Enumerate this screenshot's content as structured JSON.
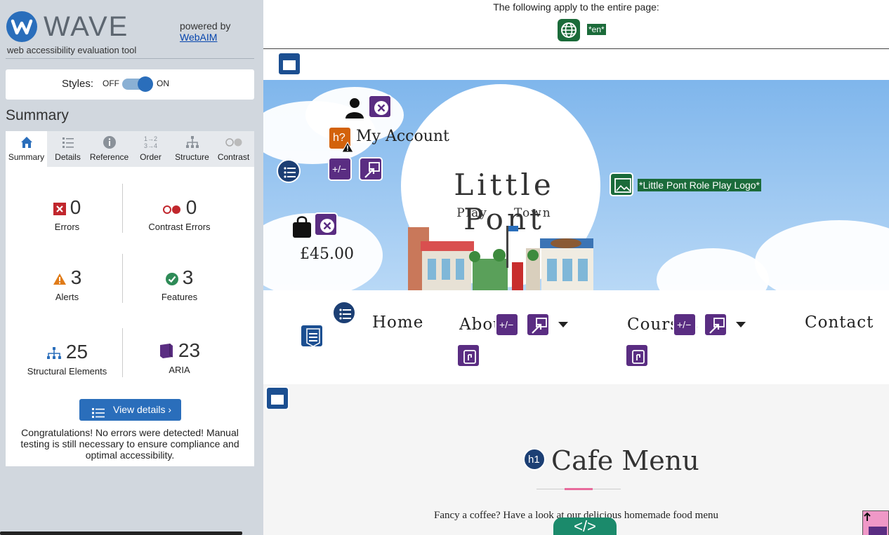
{
  "sidebar": {
    "logo_word": "WAVE",
    "logo_sub": "web accessibility evaluation tool",
    "powered_by": "powered by",
    "powered_link": "WebAIM",
    "styles_label": "Styles:",
    "styles_off": "OFF",
    "styles_on": "ON",
    "summary_title": "Summary",
    "tabs": [
      {
        "label": "Summary",
        "icon": "home-icon",
        "active": true
      },
      {
        "label": "Details",
        "icon": "list-icon"
      },
      {
        "label": "Reference",
        "icon": "info-icon"
      },
      {
        "label": "Order",
        "icon": "order-icon"
      },
      {
        "label": "Structure",
        "icon": "structure-icon"
      },
      {
        "label": "Contrast",
        "icon": "contrast-icon"
      }
    ],
    "stats": {
      "errors": {
        "value": "0",
        "label": "Errors"
      },
      "contrast_errors": {
        "value": "0",
        "label": "Contrast Errors"
      },
      "alerts": {
        "value": "3",
        "label": "Alerts"
      },
      "features": {
        "value": "3",
        "label": "Features"
      },
      "structural": {
        "value": "25",
        "label": "Structural Elements"
      },
      "aria": {
        "value": "23",
        "label": "ARIA"
      }
    },
    "details_button": "View details ›",
    "congrats": "Congratulations! No errors were detected! Manual testing is still necessary to ensure compliance and optimal accessibility."
  },
  "page": {
    "top_note": "The following apply to the entire page:",
    "lang_tag": "*en*",
    "hero_title": "Little Pont",
    "hero_sub_left": "Play",
    "hero_sub_right": "Town",
    "account_text": "My Account",
    "price": "£45.00",
    "logo_alt": "*Little Pont Role Play Logo*",
    "nav": [
      "Home",
      "About",
      "Courses",
      "Contact"
    ],
    "h1_badge": "h1",
    "heading_badge": "h?",
    "heading": "Cafe Menu",
    "intro": "Fancy a coffee? Have a look at our delicious homemade food menu",
    "code_tab": "</>"
  },
  "colors": {
    "wave_blue": "#2a6ebb",
    "aria_purple": "#5a2d82",
    "feature_green": "#1b6b3a",
    "alert_orange": "#d3620b"
  }
}
